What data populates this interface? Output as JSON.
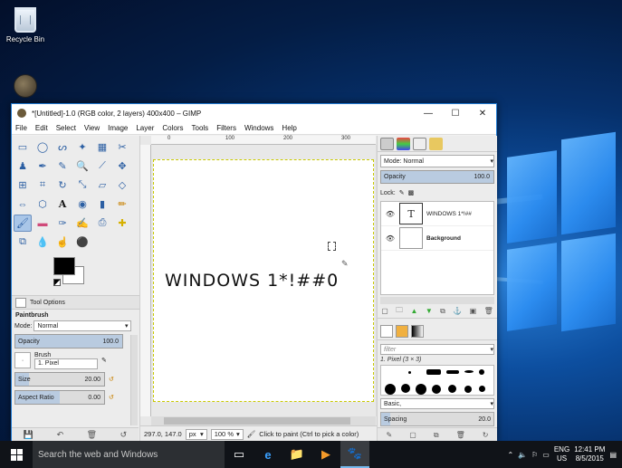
{
  "desktop": {
    "icons": [
      {
        "label": "Recycle Bin"
      }
    ]
  },
  "window": {
    "title": "*[Untitled]-1.0 (RGB color, 2 layers) 400x400 – GIMP",
    "controls": {
      "minimize": "—",
      "maximize": "☐",
      "close": "✕"
    },
    "menu": [
      "File",
      "Edit",
      "Select",
      "View",
      "Image",
      "Layer",
      "Colors",
      "Tools",
      "Filters",
      "Windows",
      "Help"
    ]
  },
  "toolbox": {
    "tool_options_tab": "Tool Options",
    "tool_title": "Paintbrush",
    "mode_label": "Mode:",
    "mode_value": "Normal",
    "opacity_label": "Opacity",
    "opacity_value": "100.0",
    "brush_label": "Brush",
    "brush_value": "1. Pixel",
    "size_label": "Size",
    "size_value": "20.00",
    "aspect_label": "Aspect Ratio",
    "aspect_value": "0.00"
  },
  "canvas": {
    "ruler_marks": [
      "0",
      "100",
      "200",
      "300"
    ],
    "image_text": "WINDOWS 1*!##0",
    "status_coords": "297.0, 147.0",
    "status_unit": "px",
    "status_zoom": "100 %",
    "status_message": "Click to paint (Ctrl to pick a color)"
  },
  "layers": {
    "mode_label": "Mode:",
    "mode_value": "Normal",
    "opacity_label": "Opacity",
    "opacity_value": "100.0",
    "lock_label": "Lock:",
    "items": [
      {
        "name": "WINDOWS 1*!##",
        "thumb": "T"
      },
      {
        "name": "Background",
        "thumb": ""
      }
    ]
  },
  "brushes": {
    "filter_placeholder": "filter",
    "current": "1. Pixel (3 × 3)",
    "preset": "Basic,",
    "spacing_label": "Spacing",
    "spacing_value": "20.0"
  },
  "taskbar": {
    "search_placeholder": "Search the web and Windows",
    "lang_top": "ENG",
    "lang_bottom": "US",
    "time": "12:41 PM",
    "date": "8/5/2015"
  },
  "colors": {
    "accent": "#1e78d0",
    "taskbar": "#101318",
    "selection": "#b9cbe0"
  }
}
